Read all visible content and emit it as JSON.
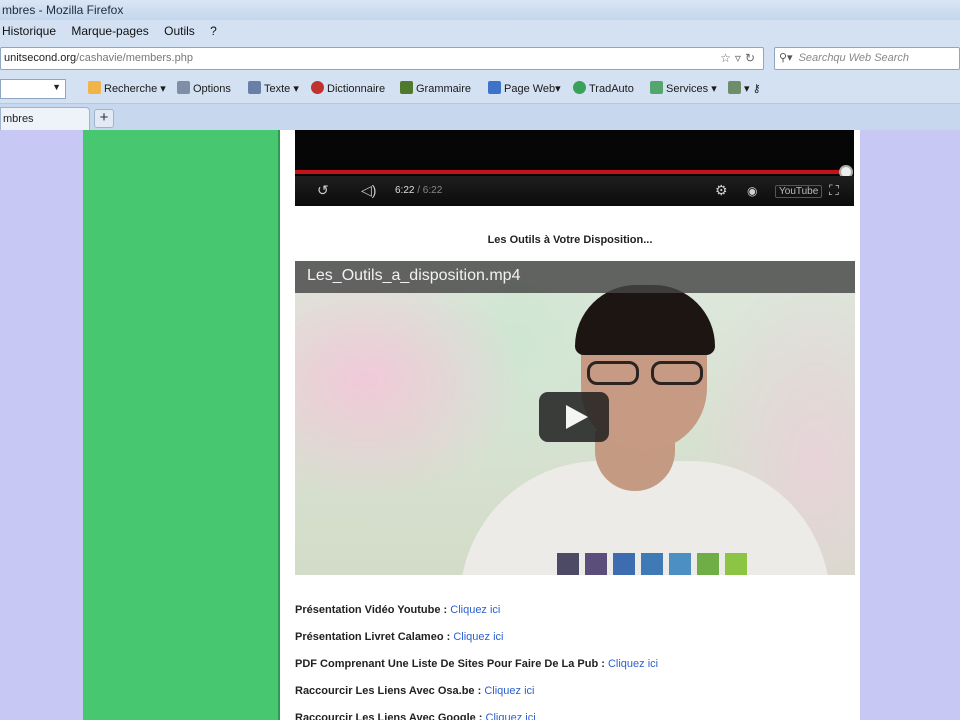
{
  "window": {
    "title": "mbres - Mozilla Firefox"
  },
  "menu": [
    "Historique",
    "Marque-pages",
    "Outils",
    "?"
  ],
  "nav": {
    "url_domain": "unitsecond.org",
    "url_path": "/cashavie/members.php",
    "search_placeholder": "Searchqu Web Search"
  },
  "toolbar": {
    "items": [
      "Recherche",
      "Options",
      "Texte",
      "Dictionnaire",
      "Grammaire",
      "Page Web",
      "TradAuto",
      "Services"
    ]
  },
  "tabs": [
    {
      "label": "mbres"
    }
  ],
  "video1": {
    "time_current": "6:22",
    "time_total": "/ 6:22",
    "progress": 1.0,
    "logo_text": "YouTube"
  },
  "section": {
    "title": "Les Outils à Votre Disposition..."
  },
  "video2": {
    "title": "Les_Outils_a_disposition.mp4"
  },
  "links": [
    {
      "label": "Présentation Vidéo Youtube : ",
      "link": "Cliquez ici"
    },
    {
      "label": "Présentation Livret Calameo : ",
      "link": "Cliquez ici"
    },
    {
      "label": "PDF Comprenant Une Liste De Sites Pour Faire De La Pub : ",
      "link": "Cliquez ici"
    },
    {
      "label": "Raccourcir Les Liens Avec Osa.be : ",
      "link": "Cliquez ici"
    },
    {
      "label": "Raccourcir Les Liens Avec Google : ",
      "link": "Cliquez ici"
    }
  ],
  "colors": {
    "accent_green": "#46c770",
    "side_lavender": "#c8c8f4",
    "link_blue": "#2a5fd0",
    "progress_red": "#c4111b"
  }
}
